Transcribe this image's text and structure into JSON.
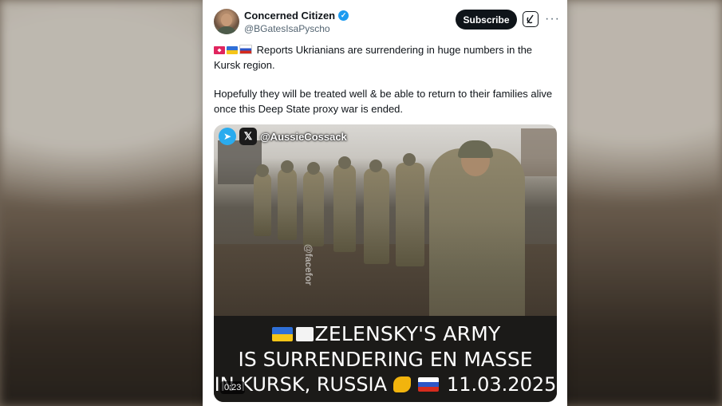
{
  "author": {
    "name": "Concerned Citizen",
    "handle": "@BGatesIsaPyscho"
  },
  "header_actions": {
    "subscribe_label": "Subscribe"
  },
  "tweet": {
    "line1": "Reports Ukrianians are surrendering in huge numbers in the Kursk region.",
    "line2": "Hopefully they will be treated well & be able to return to their families alive once this Deep State proxy war is ended."
  },
  "media": {
    "watermark": "@AussieCossack",
    "side_watermark": "@facefor",
    "banner_line1": "ZELENSKY'S ARMY",
    "banner_line2": "IS SURRENDERING EN MASSE",
    "banner_line3_a": "IN KURSK, RUSSIA",
    "banner_line3_b": "11.03.2025",
    "duration": "0:23"
  },
  "colors": {
    "accent": "#1d9bf0",
    "text": "#0f1419",
    "muted": "#536471"
  }
}
